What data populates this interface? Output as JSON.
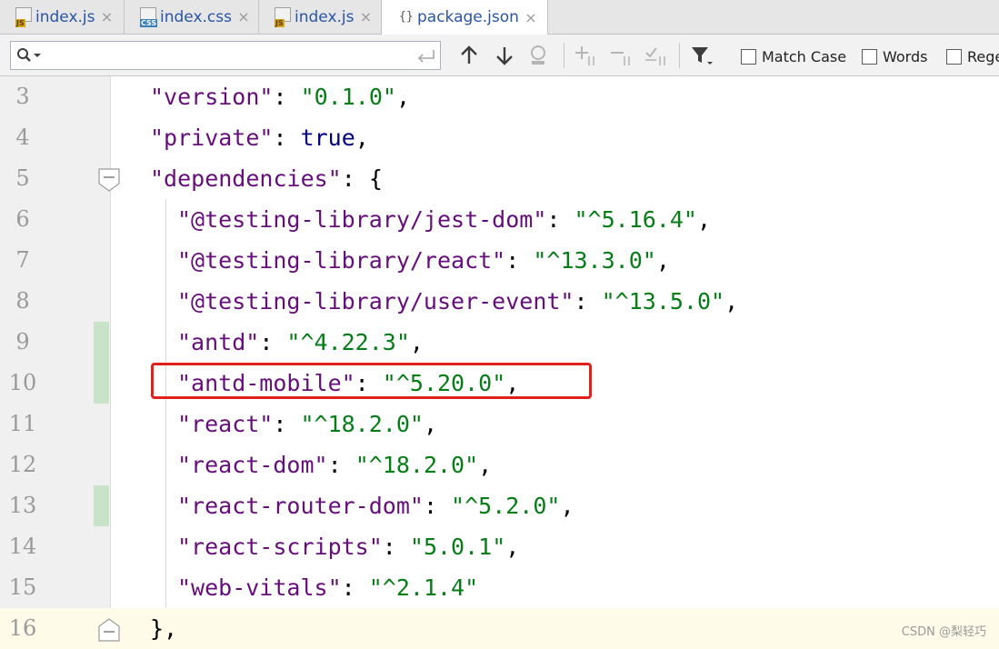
{
  "tabs": [
    {
      "label": "index.js",
      "icon": "js-file-icon",
      "badge": "JS",
      "active": false
    },
    {
      "label": "index.css",
      "icon": "css-file-icon",
      "badge": "CSS",
      "active": false
    },
    {
      "label": "index.js",
      "icon": "js-file-icon",
      "badge": "JS",
      "active": false
    },
    {
      "label": "package.json",
      "icon": "json-file-icon",
      "badge": "{}",
      "active": true
    }
  ],
  "tab_close_glyph": "×",
  "search": {
    "value": "",
    "placeholder": "",
    "options": {
      "match_case": "Match Case",
      "words": "Words",
      "regex": "Regex"
    }
  },
  "code_lines": [
    {
      "num": "3",
      "indent": 1,
      "tokens": [
        [
          "\"version\"",
          "k"
        ],
        [
          ": ",
          "p"
        ],
        [
          "\"0.1.0\"",
          "s"
        ],
        [
          ",",
          "p"
        ]
      ]
    },
    {
      "num": "4",
      "indent": 1,
      "tokens": [
        [
          "\"private\"",
          "k"
        ],
        [
          ": ",
          "p"
        ],
        [
          "true",
          "b"
        ],
        [
          ",",
          "p"
        ]
      ]
    },
    {
      "num": "5",
      "indent": 1,
      "fold": "open",
      "tokens": [
        [
          "\"dependencies\"",
          "k"
        ],
        [
          ": {",
          "p"
        ]
      ]
    },
    {
      "num": "6",
      "indent": 2,
      "tokens": [
        [
          "\"@testing-library/jest-dom\"",
          "k"
        ],
        [
          ": ",
          "p"
        ],
        [
          "\"^5.16.4\"",
          "s"
        ],
        [
          ",",
          "p"
        ]
      ]
    },
    {
      "num": "7",
      "indent": 2,
      "tokens": [
        [
          "\"@testing-library/react\"",
          "k"
        ],
        [
          ": ",
          "p"
        ],
        [
          "\"^13.3.0\"",
          "s"
        ],
        [
          ",",
          "p"
        ]
      ]
    },
    {
      "num": "8",
      "indent": 2,
      "tokens": [
        [
          "\"@testing-library/user-event\"",
          "k"
        ],
        [
          ": ",
          "p"
        ],
        [
          "\"^13.5.0\"",
          "s"
        ],
        [
          ",",
          "p"
        ]
      ]
    },
    {
      "num": "9",
      "indent": 2,
      "changed": true,
      "tokens": [
        [
          "\"antd\"",
          "k"
        ],
        [
          ": ",
          "p"
        ],
        [
          "\"^4.22.3\"",
          "s"
        ],
        [
          ",",
          "p"
        ]
      ]
    },
    {
      "num": "10",
      "indent": 2,
      "changed": true,
      "highlighted": true,
      "tokens": [
        [
          "\"antd-mobile\"",
          "k"
        ],
        [
          ": ",
          "p"
        ],
        [
          "\"^5.20.0\"",
          "s"
        ],
        [
          ",",
          "p"
        ]
      ]
    },
    {
      "num": "11",
      "indent": 2,
      "tokens": [
        [
          "\"react\"",
          "k"
        ],
        [
          ": ",
          "p"
        ],
        [
          "\"^18.2.0\"",
          "s"
        ],
        [
          ",",
          "p"
        ]
      ]
    },
    {
      "num": "12",
      "indent": 2,
      "tokens": [
        [
          "\"react-dom\"",
          "k"
        ],
        [
          ": ",
          "p"
        ],
        [
          "\"^18.2.0\"",
          "s"
        ],
        [
          ",",
          "p"
        ]
      ]
    },
    {
      "num": "13",
      "indent": 2,
      "changed": true,
      "tokens": [
        [
          "\"react-router-dom\"",
          "k"
        ],
        [
          ": ",
          "p"
        ],
        [
          "\"^5.2.0\"",
          "s"
        ],
        [
          ",",
          "p"
        ]
      ]
    },
    {
      "num": "14",
      "indent": 2,
      "tokens": [
        [
          "\"react-scripts\"",
          "k"
        ],
        [
          ": ",
          "p"
        ],
        [
          "\"5.0.1\"",
          "s"
        ],
        [
          ",",
          "p"
        ]
      ]
    },
    {
      "num": "15",
      "indent": 2,
      "tokens": [
        [
          "\"web-vitals\"",
          "k"
        ],
        [
          ": ",
          "p"
        ],
        [
          "\"^2.1.4\"",
          "s"
        ]
      ]
    },
    {
      "num": "16",
      "indent": 1,
      "fold": "close",
      "current": true,
      "tokens": [
        [
          "},",
          "p"
        ]
      ]
    }
  ],
  "colors": {
    "key": "#660e7a",
    "string": "#067d17",
    "boolean": "#000080",
    "change_marker": "#c9e3c9",
    "highlight_box": "#e0201b",
    "current_line": "#fefbe8"
  },
  "watermark": "CSDN @梨轻巧"
}
